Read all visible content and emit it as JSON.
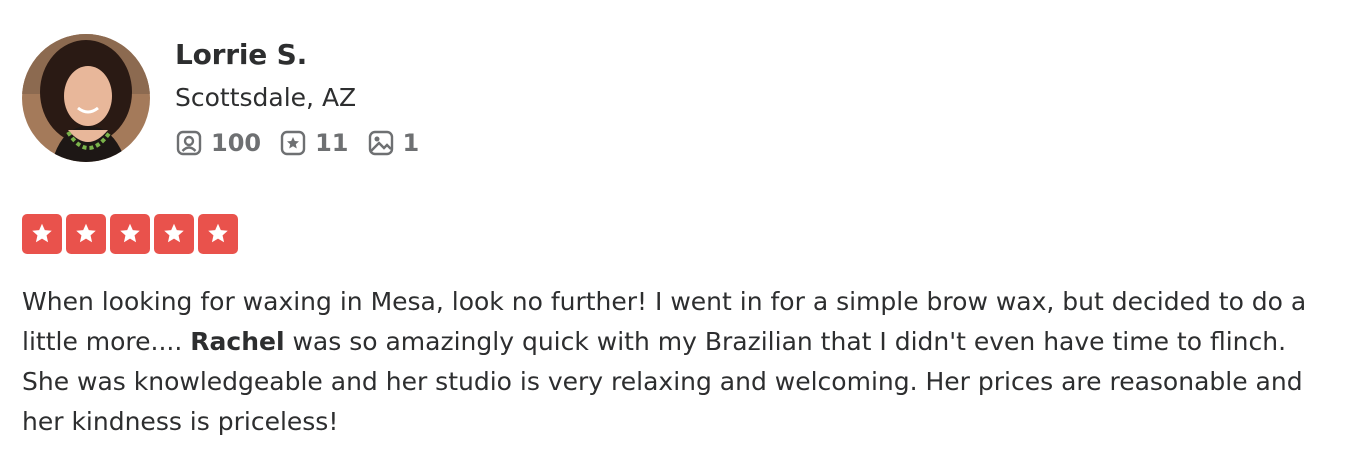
{
  "reviewer": {
    "name": "Lorrie S.",
    "location": "Scottsdale, AZ",
    "friends_count": "100",
    "reviews_count": "11",
    "photos_count": "1",
    "avatar_icon": "user-photo"
  },
  "review": {
    "rating": 5,
    "rating_color": "#e9524c",
    "text_part1": "When looking for waxing in Mesa, look no further! I went in for a simple brow wax, but decided to do a little more.... ",
    "highlight": "Rachel",
    "text_part2": " was so amazingly quick with my Brazilian that I didn't even have time to flinch. She was knowledgeable and her studio is very relaxing and welcoming. Her prices are reasonable and her kindness is priceless!"
  }
}
